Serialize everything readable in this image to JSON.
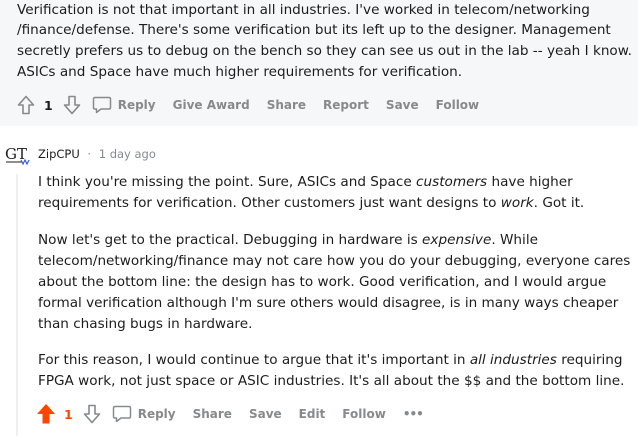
{
  "parent_comment": {
    "body_lines": [
      "Verification is not that important in all industries. I've worked in telecom/networking",
      "/finance/defense. There's some verification but its left up to the designer. Management",
      "secretly prefers us to debug on the bench so they can see us out in the lab -- yeah I know.",
      "ASICs and Space have much higher requirements for verification."
    ],
    "vote_count": "1",
    "actions": {
      "reply": "Reply",
      "give_award": "Give Award",
      "share": "Share",
      "report": "Report",
      "save": "Save",
      "follow": "Follow"
    }
  },
  "reply_comment": {
    "author": "ZipCPU",
    "separator": "·",
    "timestamp": "1 day ago",
    "paragraphs": {
      "p1": {
        "a": "I think you're missing the point. Sure, ASICs and Space ",
        "b": "customers",
        "c": " have higher",
        "d": "requirements for verification. Other customers just want designs to ",
        "e": "work",
        "f": ". Got it."
      },
      "p2": {
        "a": "Now let's get to the practical. Debugging in hardware is ",
        "b": "expensive",
        "c": ". While",
        "d": "telecom/networking/finance may not care how you do your debugging, everyone cares",
        "e": "about the bottom line: the design has to work. Good verification, and I would argue",
        "f": "formal verification although I'm sure others would disagree, is in many ways cheaper",
        "g": "than chasing bugs in hardware."
      },
      "p3": {
        "a": "For this reason, I would continue to argue that it's important in ",
        "b": "all industries",
        "c": " requiring",
        "d": "FPGA work, not just space or ASIC industries. It's all about the $$ and the bottom line."
      }
    },
    "vote_count": "1",
    "actions": {
      "reply": "Reply",
      "share": "Share",
      "save": "Save",
      "edit": "Edit",
      "follow": "Follow",
      "more": "•••"
    }
  },
  "colors": {
    "upvoted": "#ff4500",
    "meta_gray": "#878a8c",
    "text": "#1c1c1c",
    "highlight_bg": "#f6f7f8"
  },
  "icons": {
    "upvote": "upvote-arrow-icon",
    "downvote": "downvote-arrow-icon",
    "comment": "comment-bubble-icon",
    "avatar": "gt-logo-avatar"
  }
}
